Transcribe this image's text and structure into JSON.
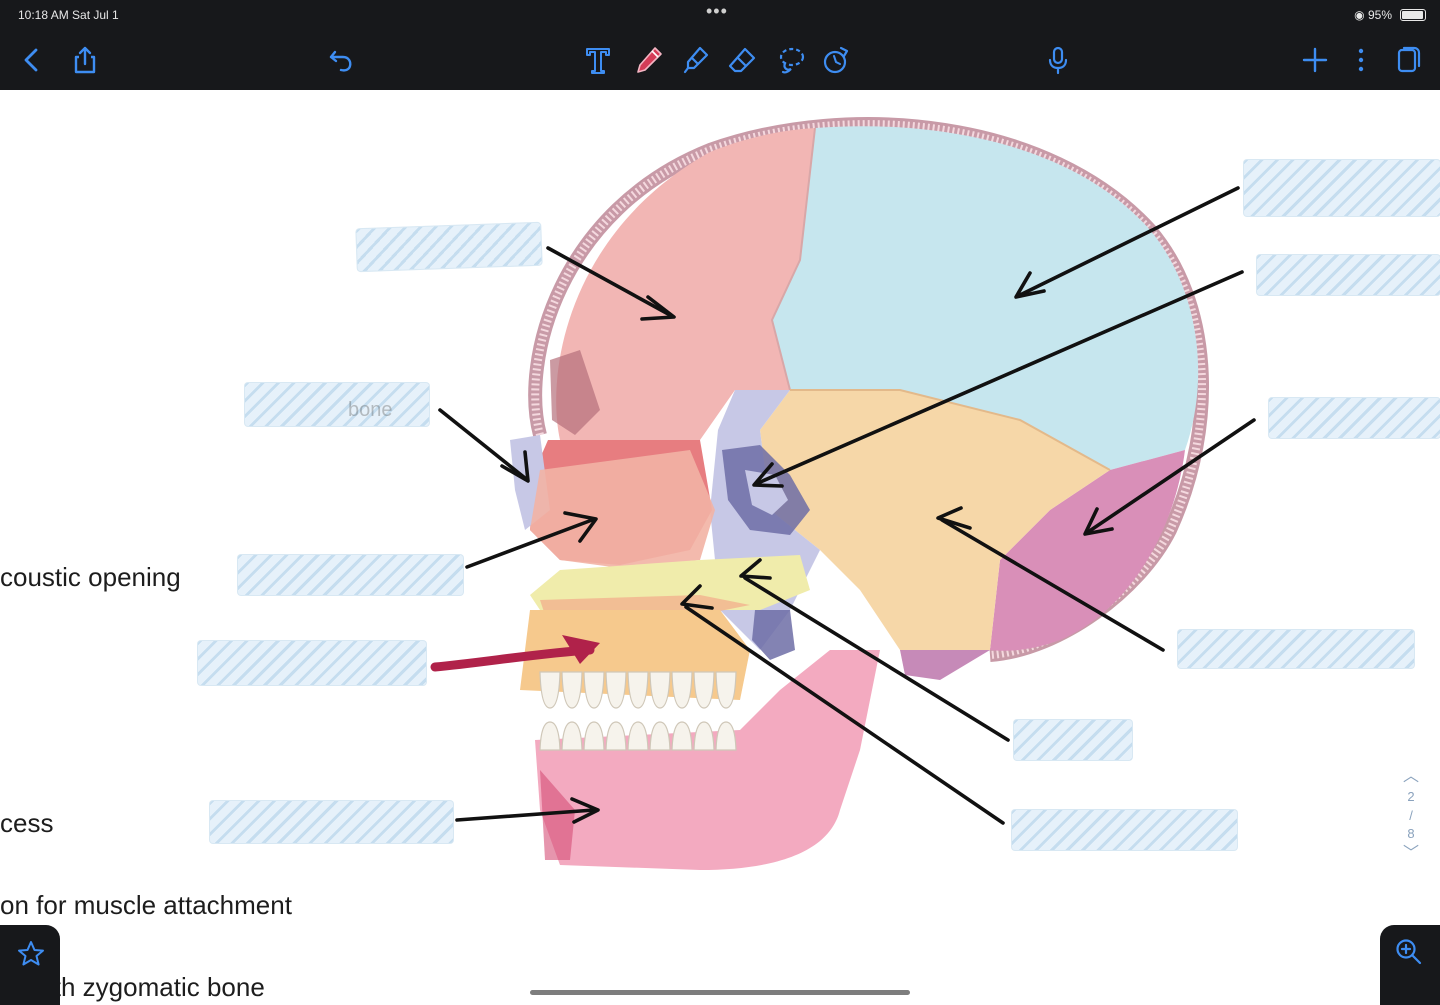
{
  "status_bar": {
    "time": "10:18 AM   Sat Jul 1",
    "battery": "95%",
    "battery_level": 0.95
  },
  "toolbar": {
    "left_tools": [
      "back-icon",
      "share-icon",
      "undo-icon"
    ],
    "center_tools": [
      "text-tool-icon",
      "pen-tool-icon",
      "highlighter-tool-icon",
      "eraser-tool-icon",
      "lasso-tool-icon",
      "shapes-tool-icon"
    ],
    "right_tools": [
      "microphone-icon",
      "add-page-icon",
      "more-icon",
      "pages-icon"
    ],
    "accent_color": "#3e8df2",
    "pen_color": "#d43c57"
  },
  "page_text": {
    "line1": "coustic opening",
    "line2": "cess",
    "line3": "on for muscle attachment",
    "line4": "ith zygomatic bone",
    "partial_word": "bone"
  },
  "pager": {
    "current": "2",
    "separator": "/",
    "total": "8"
  },
  "colors": {
    "frontal": "#f2b6b4",
    "parietal": "#c6e6ee",
    "temporal": "#f6d7a8",
    "occipital": "#d98fb8",
    "sphenoid": "#c7c8e6",
    "maxilla": "#f6c98d",
    "zygomatic": "#f2b2a4",
    "palatine": "#f0ecab",
    "mandible": "#f3aac0",
    "teeth": "#f6f3ec",
    "annotation": "#b0224a"
  }
}
